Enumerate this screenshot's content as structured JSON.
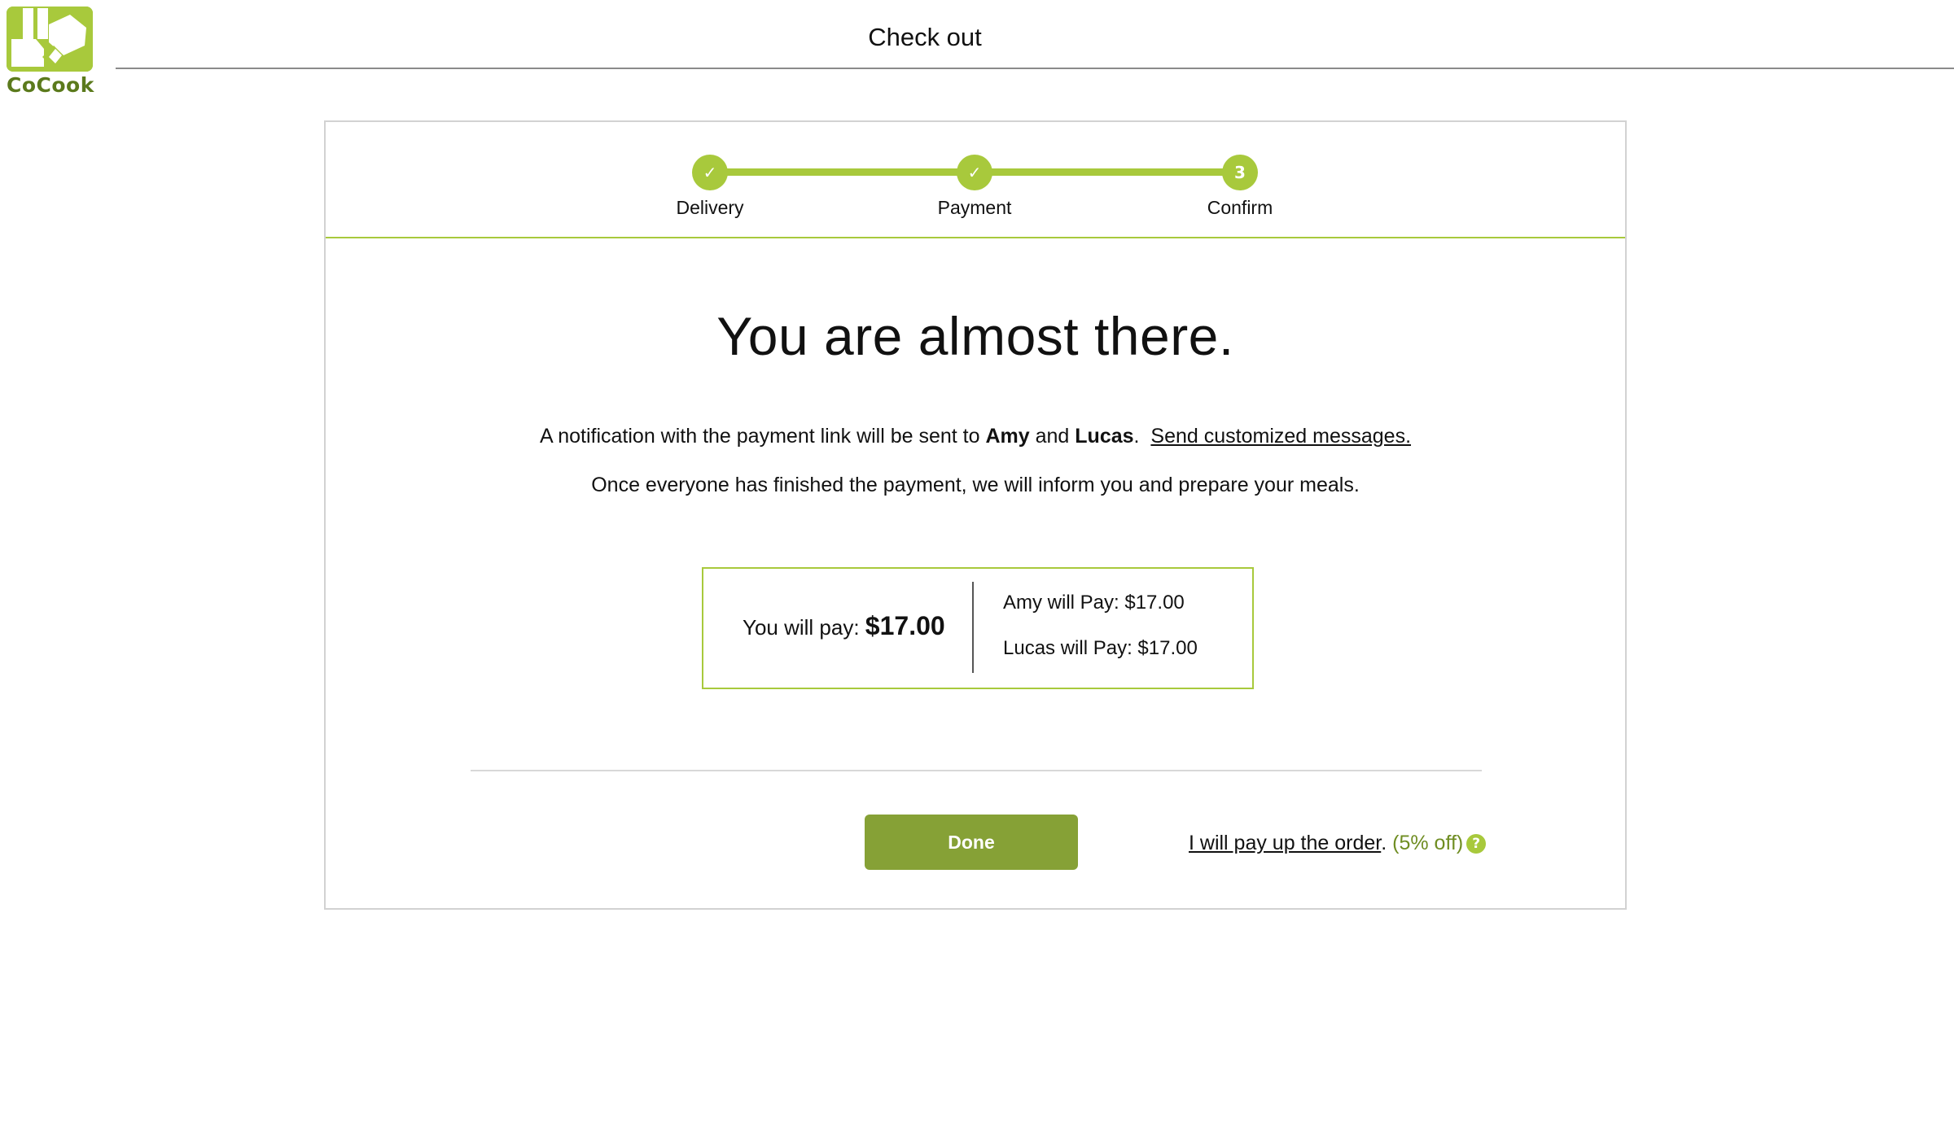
{
  "brand": {
    "name": "CoCook",
    "accent_color": "#a8c93c",
    "button_color": "#86a136"
  },
  "header": {
    "title": "Check out"
  },
  "stepper": {
    "steps": [
      {
        "label": "Delivery",
        "marker": "✓",
        "state": "complete"
      },
      {
        "label": "Payment",
        "marker": "✓",
        "state": "complete"
      },
      {
        "label": "Confirm",
        "marker": "3",
        "state": "current"
      }
    ]
  },
  "main": {
    "headline": "You are almost there.",
    "notification": {
      "prefix": "A notification with the payment link will be sent to ",
      "person1": "Amy",
      "and": " and ",
      "person2": "Lucas",
      "period": ".",
      "link": "Send customized messages."
    },
    "inform_text": "Once everyone has finished the payment, we will inform you and prepare your meals."
  },
  "payment": {
    "self_label": "You will pay: ",
    "self_amount": "$17.00",
    "others": [
      {
        "label": "Amy will Pay: $17.00"
      },
      {
        "label": "Lucas will Pay: $17.00"
      }
    ]
  },
  "actions": {
    "done_label": "Done",
    "pay_up_link": "I will pay up the order",
    "pay_up_period": ".",
    "discount": "(5% off)",
    "help_icon": "?"
  }
}
